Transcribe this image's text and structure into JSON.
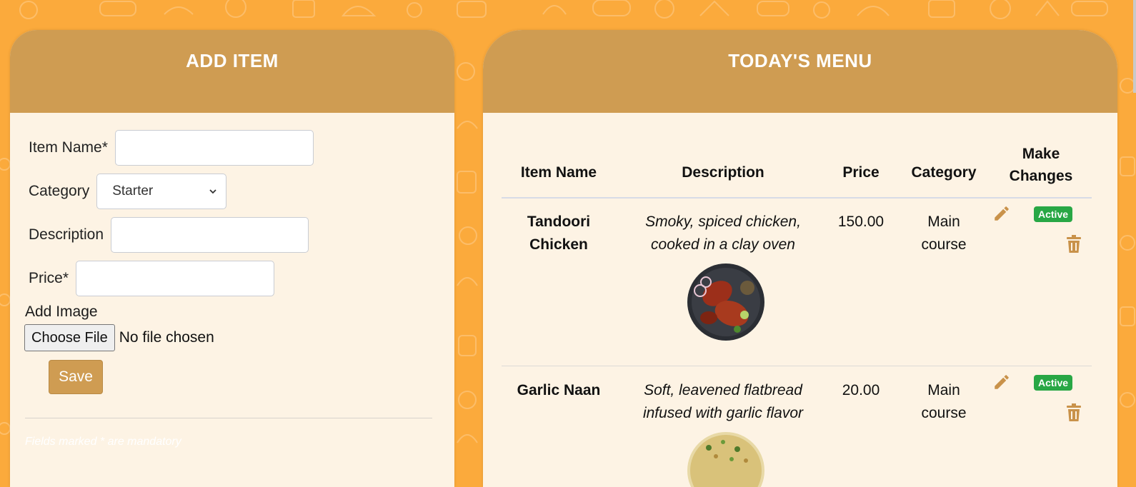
{
  "add_item": {
    "title": "ADD ITEM",
    "item_name_label": "Item Name*",
    "category_label": "Category",
    "category_value": "Starter",
    "description_label": "Description",
    "price_label": "Price*",
    "add_image_label": "Add Image",
    "choose_file_label": "Choose File",
    "no_file_text": "No file chosen",
    "save_label": "Save",
    "mandatory_note": "Fields marked * are mandatory"
  },
  "menu": {
    "title": "TODAY'S MENU",
    "headers": {
      "name": "Item Name",
      "description": "Description",
      "price": "Price",
      "category": "Category",
      "changes_line1": "Make",
      "changes_line2": "Changes"
    },
    "rows": [
      {
        "name_line1": "Tandoori",
        "name_line2": "Chicken",
        "desc_line1": "Smoky, spiced chicken,",
        "desc_line2": "cooked in a clay oven",
        "price": "150.00",
        "category_line1": "Main",
        "category_line2": "course",
        "status": "Active"
      },
      {
        "name_line1": "Garlic Naan",
        "name_line2": "",
        "desc_line1": "Soft, leavened flatbread",
        "desc_line2": "infused with garlic flavor",
        "price": "20.00",
        "category_line1": "Main",
        "category_line2": "course",
        "status": "Active"
      }
    ]
  },
  "colors": {
    "background": "#fbaa3c",
    "panel_header": "#cf9c52",
    "panel_body": "#fdf3e4",
    "badge": "#28a745",
    "icon": "#c9924a"
  },
  "icons": [
    "pencil-icon",
    "trash-icon",
    "chevron-down-icon"
  ]
}
